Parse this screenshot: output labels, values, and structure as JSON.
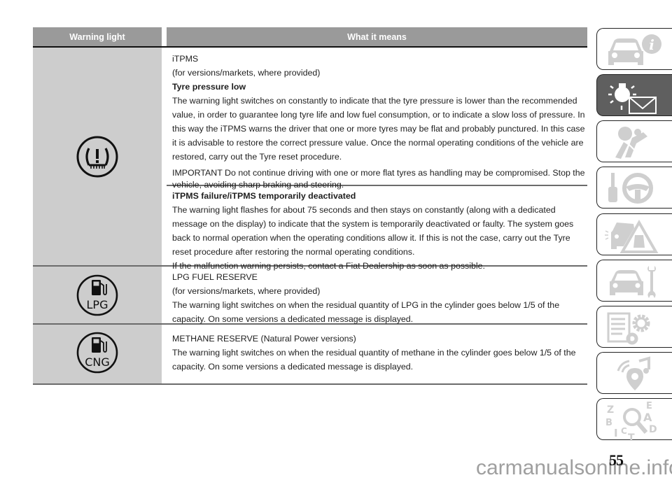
{
  "table": {
    "headers": {
      "warning_light": "Warning light",
      "what_it_means": "What it means"
    },
    "rows": [
      {
        "icon": "tyre-pressure-warning-icon",
        "blocks": [
          {
            "lines": [
              {
                "text": "iTPMS",
                "bold": false
              },
              {
                "text": "(for versions/markets, where provided)",
                "bold": false
              },
              {
                "text": "Tyre pressure low",
                "bold": true
              },
              {
                "text": "The warning light switches on constantly to indicate that the tyre pressure is lower than the recommended value, in order to guarantee long tyre life and low fuel consumption, or to indicate a slow loss of pressure. In this way the iTPMS warns the driver that one or more tyres may be flat and probably punctured. In this case it is advisable to restore the correct pressure value. Once the normal operating conditions of the vehicle are restored, carry out the Tyre reset procedure.",
                "bold": false
              }
            ],
            "important": "IMPORTANT Do not continue driving with one or more flat tyres as handling may be compromised. Stop the vehicle, avoiding sharp braking and steering."
          },
          {
            "lines": [
              {
                "text": "iTPMS failure/iTPMS temporarily deactivated",
                "bold": true
              },
              {
                "text": "The warning light flashes for about 75 seconds and then stays on constantly (along with a dedicated message on the display) to indicate that the system is temporarily deactivated or faulty. The system goes back to normal operation when the operating conditions allow it. If this is not the case, carry out the Tyre reset procedure after restoring the normal operating conditions.",
                "bold": false
              },
              {
                "text": "If the malfunction warning persists, contact a Fiat Dealership as soon as possible.",
                "bold": false
              }
            ]
          }
        ]
      },
      {
        "icon": "lpg-fuel-icon",
        "icon_label": "LPG",
        "lines": [
          {
            "text": "LPG FUEL RESERVE",
            "bold": false
          },
          {
            "text": "(for versions/markets, where provided)",
            "bold": false
          },
          {
            "text": "The warning light switches on when the residual quantity of LPG in the cylinder goes below 1/5 of the capacity. On some versions a dedicated message is displayed.",
            "bold": false
          }
        ]
      },
      {
        "icon": "cng-fuel-icon",
        "icon_label": "CNG",
        "lines": [
          {
            "text": "METHANE RESERVE (Natural Power versions)",
            "bold": false
          },
          {
            "text": "The warning light switches on when the residual quantity of methane in the cylinder goes below 1/5 of the capacity. On some versions a dedicated message is displayed.",
            "bold": false
          }
        ]
      }
    ]
  },
  "sidebar": {
    "tabs": [
      {
        "icon": "car-info-icon",
        "active": false
      },
      {
        "icon": "warning-light-message-icon",
        "active": true
      },
      {
        "icon": "airbag-seat-icon",
        "active": false
      },
      {
        "icon": "key-steering-wheel-icon",
        "active": false
      },
      {
        "icon": "car-accident-warning-icon",
        "active": false
      },
      {
        "icon": "car-wrench-icon",
        "active": false
      },
      {
        "icon": "specifications-gears-icon",
        "active": false
      },
      {
        "icon": "multimedia-icon",
        "active": false
      },
      {
        "icon": "index-search-icon",
        "active": false
      }
    ],
    "index_letters": [
      "Z",
      "E",
      "A",
      "B",
      "D",
      "I",
      "C",
      "T"
    ]
  },
  "page_number": "55",
  "watermark": "carmanualsonline.info",
  "colors": {
    "header_bg": "#9a9a9a",
    "icon_column_bg": "#cdcdcd",
    "active_tab_bg": "#5f5f5f",
    "tab_icon": "#cfcfcf"
  }
}
